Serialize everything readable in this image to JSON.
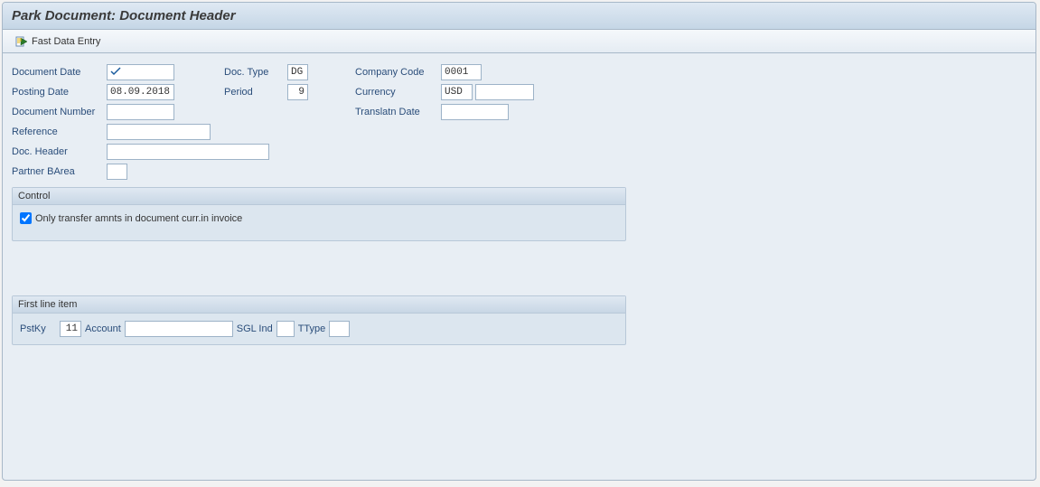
{
  "header": {
    "title": "Park Document: Document Header"
  },
  "toolbar": {
    "fast_entry": "Fast Data Entry"
  },
  "form": {
    "document_date": {
      "label": "Document Date",
      "value": ""
    },
    "doc_type": {
      "label": "Doc. Type",
      "value": "DG"
    },
    "company_code": {
      "label": "Company Code",
      "value": "0001"
    },
    "posting_date": {
      "label": "Posting Date",
      "value": "08.09.2018"
    },
    "period": {
      "label": "Period",
      "value": "9"
    },
    "currency": {
      "label": "Currency",
      "value": "USD",
      "extra": ""
    },
    "document_number": {
      "label": "Document Number",
      "value": ""
    },
    "translation_date": {
      "label": "Translatn Date",
      "value": ""
    },
    "reference": {
      "label": "Reference",
      "value": ""
    },
    "doc_header": {
      "label": "Doc. Header",
      "value": ""
    },
    "partner_barea": {
      "label": "Partner BArea",
      "value": ""
    }
  },
  "control": {
    "title": "Control",
    "transfer_amounts": {
      "label": "Only transfer amnts in document curr.in invoice",
      "checked": true
    }
  },
  "line_item": {
    "title": "First line item",
    "pstky": {
      "label": "PstKy",
      "value": "11"
    },
    "account": {
      "label": "Account",
      "value": ""
    },
    "sgl_ind": {
      "label": "SGL Ind",
      "value": ""
    },
    "ttype": {
      "label": "TType",
      "value": ""
    }
  }
}
